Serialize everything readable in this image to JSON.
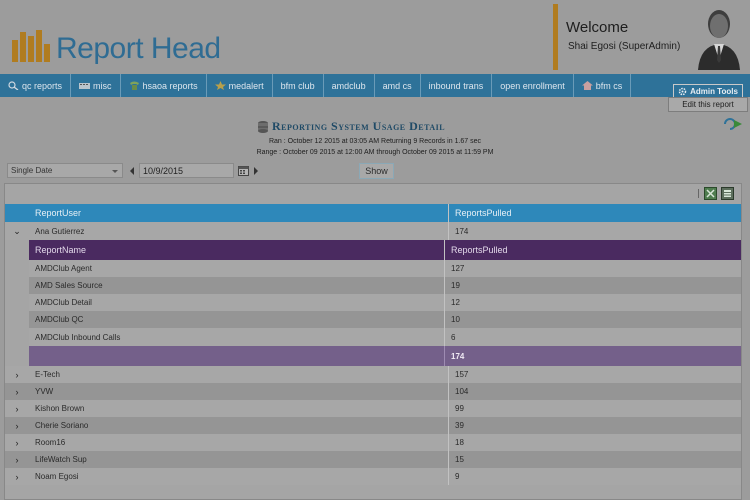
{
  "header": {
    "app_title": "Report Head",
    "welcome": "Welcome",
    "user": "Shai Egosi (SuperAdmin)"
  },
  "nav": {
    "items": [
      {
        "label": "qc reports",
        "icon": "search-icon"
      },
      {
        "label": "misc",
        "icon": "keyboard-icon"
      },
      {
        "label": "hsaoa reports",
        "icon": "phone-icon"
      },
      {
        "label": "medalert",
        "icon": "star-icon"
      },
      {
        "label": "bfm club",
        "icon": ""
      },
      {
        "label": "amdclub",
        "icon": ""
      },
      {
        "label": "amd cs",
        "icon": ""
      },
      {
        "label": "inbound trans",
        "icon": ""
      },
      {
        "label": "open enrollment",
        "icon": ""
      },
      {
        "label": "bfm cs",
        "icon": "home-icon"
      }
    ],
    "admin_tools": "Admin Tools",
    "edit_report": "Edit this report"
  },
  "report": {
    "title": "Reporting System Usage Detail",
    "ran": "Ran : October 12 2015 at 03:05 AM Returning 9 Records in 1.67 sec",
    "range": "Range : October 09 2015 at 12:00 AM through October 09 2015 at 11:59 PM"
  },
  "filter": {
    "mode": "Single Date",
    "date": "10/9/2015",
    "show_label": "Show"
  },
  "grid": {
    "col_user": "ReportUser",
    "col_pulled": "ReportsPulled",
    "sub_col_name": "ReportName",
    "sub_col_pulled": "ReportsPulled",
    "expanded_user": {
      "name": "Ana Gutierrez",
      "pulled": "174"
    },
    "details": [
      {
        "name": "AMDClub Agent",
        "pulled": "127"
      },
      {
        "name": "AMD Sales Source",
        "pulled": "19"
      },
      {
        "name": "AMDClub Detail",
        "pulled": "12"
      },
      {
        "name": "AMDClub QC",
        "pulled": "10"
      },
      {
        "name": "AMDClub Inbound Calls",
        "pulled": "6"
      }
    ],
    "detail_total": "174",
    "users": [
      {
        "name": "E-Tech",
        "pulled": "157"
      },
      {
        "name": "YVW",
        "pulled": "104"
      },
      {
        "name": "Kishon Brown",
        "pulled": "99"
      },
      {
        "name": "Cherie Soriano",
        "pulled": "39"
      },
      {
        "name": "Room16",
        "pulled": "18"
      },
      {
        "name": "LifeWatch Sup",
        "pulled": "15"
      },
      {
        "name": "Noam Egosi",
        "pulled": "9"
      }
    ]
  }
}
